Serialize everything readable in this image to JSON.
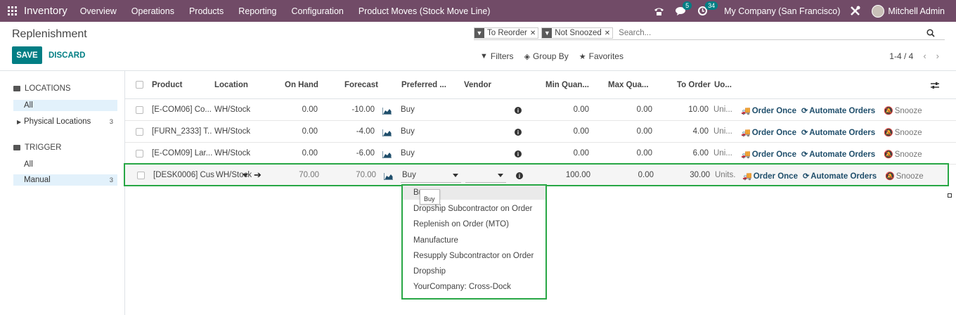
{
  "navbar": {
    "app_name": "Inventory",
    "menu": [
      "Overview",
      "Operations",
      "Products",
      "Reporting",
      "Configuration",
      "Product Moves (Stock Move Line)"
    ],
    "messages_count": "5",
    "activities_count": "34",
    "company": "My Company (San Francisco)",
    "user": "Mitchell Admin",
    "icons": [
      "apps-grid-icon",
      "phone-icon",
      "chat-icon",
      "clock-icon",
      "tools-icon"
    ]
  },
  "control_panel": {
    "title": "Replenishment",
    "save_label": "SAVE",
    "discard_label": "DISCARD",
    "facets": [
      "To Reorder",
      "Not Snoozed"
    ],
    "search_placeholder": "Search...",
    "filters_label": "Filters",
    "group_by_label": "Group By",
    "favorites_label": "Favorites",
    "pager": "1-4 / 4"
  },
  "sidebar": {
    "locations_header": "LOCATIONS",
    "locations": [
      {
        "label": "All",
        "count": ""
      },
      {
        "label": "Physical Locations",
        "count": "3"
      }
    ],
    "trigger_header": "TRIGGER",
    "triggers": [
      {
        "label": "All",
        "count": ""
      },
      {
        "label": "Manual",
        "count": "3"
      }
    ]
  },
  "table": {
    "columns": [
      "Product",
      "Location",
      "On Hand",
      "Forecast",
      "Preferred ...",
      "Vendor",
      "Min Quan...",
      "Max Qua...",
      "To Order",
      "Uo..."
    ],
    "rows": [
      {
        "product": "[E-COM06] Co...",
        "location": "WH/Stock",
        "on_hand": "0.00",
        "forecast": "-10.00",
        "route": "Buy",
        "min": "0.00",
        "max": "0.00",
        "to_order": "10.00",
        "uom": "Uni..."
      },
      {
        "product": "[FURN_2333] T...",
        "location": "WH/Stock",
        "on_hand": "0.00",
        "forecast": "-4.00",
        "route": "Buy",
        "min": "0.00",
        "max": "0.00",
        "to_order": "4.00",
        "uom": "Uni..."
      },
      {
        "product": "[E-COM09] Lar...",
        "location": "WH/Stock",
        "on_hand": "0.00",
        "forecast": "-6.00",
        "route": "Buy",
        "min": "0.00",
        "max": "0.00",
        "to_order": "6.00",
        "uom": "Uni..."
      },
      {
        "product": "[DESK0006] Custo",
        "location": "WH/Stock",
        "on_hand": "70.00",
        "forecast": "70.00",
        "route": "Buy",
        "min": "100.00",
        "max": "0.00",
        "to_order": "30.00",
        "uom": "Units."
      }
    ],
    "actions": {
      "order_once": "Order Once",
      "automate": "Automate Orders",
      "snooze": "Snooze"
    }
  },
  "route_dropdown": {
    "options": [
      "Buy",
      "Dropship Subcontractor on Order",
      "Replenish on Order (MTO)",
      "Manufacture",
      "Resupply Subcontractor on Order",
      "Dropship",
      "YourCompany: Cross-Dock"
    ],
    "highlighted": "Buy",
    "tooltip": "Buy"
  },
  "colors": {
    "navbar": "#714b67",
    "primary": "#017e84",
    "highlight_border": "#28a745",
    "action_text": "#1f4e6b"
  }
}
